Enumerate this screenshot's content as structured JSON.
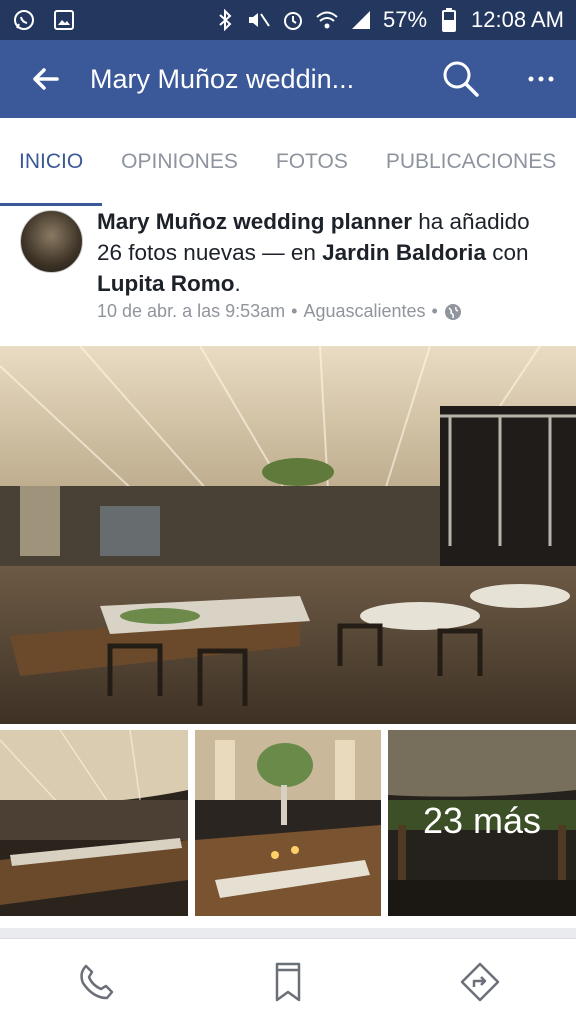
{
  "status_bar": {
    "battery": "57%",
    "time": "12:08 AM",
    "icons": [
      "whatsapp-icon",
      "gallery-icon",
      "bluetooth-icon",
      "mute-icon",
      "alarm-icon",
      "wifi-icon",
      "signal-icon",
      "battery-icon"
    ]
  },
  "app_bar": {
    "title": "Mary Muñoz weddin...",
    "color": "#3b5998"
  },
  "tabs": [
    {
      "label": "INICIO",
      "active": true
    },
    {
      "label": "OPINIONES",
      "active": false
    },
    {
      "label": "FOTOS",
      "active": false
    },
    {
      "label": "PUBLICACIONES",
      "active": false
    }
  ],
  "post": {
    "author": "Mary Muñoz wedding planner",
    "action": " ha añadido 26 fotos nuevas — en ",
    "place": "Jardin Baldoria",
    "with": " con ",
    "tagged": "Lupita Romo",
    "end": ".",
    "date": "10 de abr. a las 9:53am",
    "sep": " • ",
    "location": "Aguascalientes",
    "sep2": " •",
    "more_photos": "23 más"
  },
  "actions": [
    "phone-icon",
    "bookmark-icon",
    "directions-icon"
  ]
}
